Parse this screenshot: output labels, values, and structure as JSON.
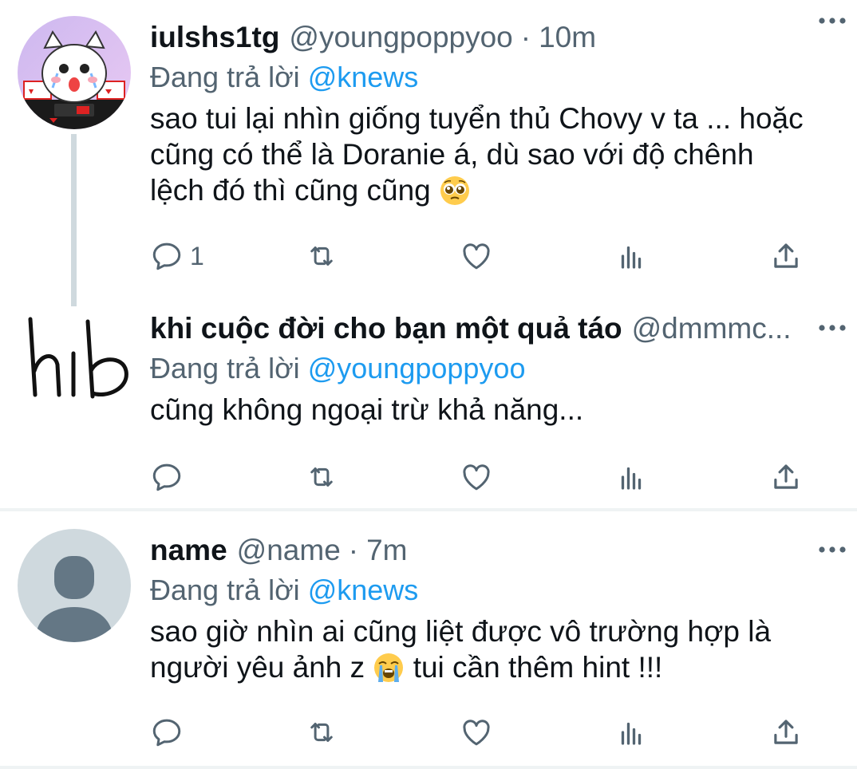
{
  "tweets": [
    {
      "name": "iulshs1tg",
      "handle": "@youngpoppyoo",
      "separator": "·",
      "time": "10m",
      "reply_prefix": "Đang trả lời",
      "reply_mention": "@knews",
      "text_lines": [
        "sao tui lại nhìn giống tuyển thủ Chovy v ta ... hoặc",
        "cũng có thể là Doranie á, dù sao với độ chênh",
        "lệch đó thì cũng cũng"
      ],
      "emoji": "pleading-face-icon",
      "reply_count": "1"
    },
    {
      "name": "khi cuộc đời cho bạn một quả táo",
      "handle": "@dmmmc...",
      "reply_prefix": "Đang trả lời",
      "reply_mention": "@youngpoppyoo",
      "text_lines": [
        "cũng không ngoại trừ khả năng..."
      ],
      "reply_count": "",
      "avatar_handwriting": "hib"
    },
    {
      "name": "name",
      "handle": "@name",
      "separator": "·",
      "time": "7m",
      "reply_prefix": "Đang trả lời",
      "reply_mention": "@knews",
      "text_lines": [
        "sao giờ nhìn ai cũng liệt được vô trường hợp là",
        "người yêu ảnh z",
        "tui cần thêm hint !!!"
      ],
      "emoji": "loudly-crying-face-icon",
      "reply_count": ""
    }
  ],
  "colors": {
    "text": "#0f1419",
    "secondary": "#536471",
    "link": "#1d9bf0",
    "border": "#eff3f4",
    "thread_line": "#cfd9de"
  },
  "icons": [
    "more-icon",
    "reply-icon",
    "retweet-icon",
    "like-icon",
    "analytics-icon",
    "share-icon"
  ]
}
